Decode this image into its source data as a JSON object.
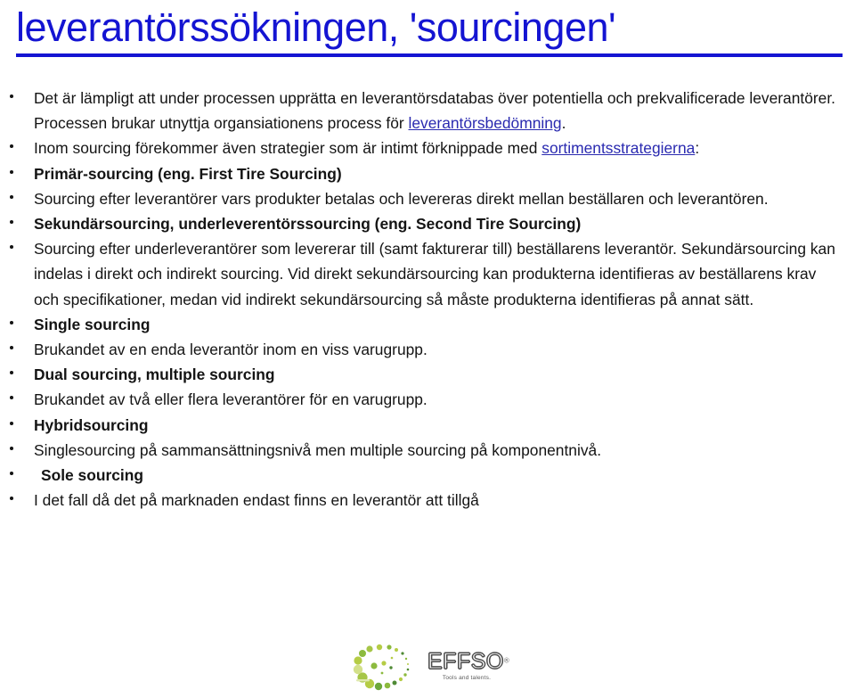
{
  "slide": {
    "title": "leverantörssökningen, 'sourcingen'",
    "title_color": "#1414d2",
    "link_color": "#2a2ab0",
    "text_color": "#141414",
    "background": "#ffffff"
  },
  "bullets": [
    {
      "id": "intro-database",
      "bold": false,
      "segments": [
        {
          "text": "Det är lämpligt att under processen upprätta en leverantörsdatabas över potentiella och prekvalificerade leverantörer. Processen brukar utnyttja organsiationens process för ",
          "link": false
        },
        {
          "text": "leverantörsbedömning",
          "link": true
        },
        {
          "text": ".",
          "link": false
        }
      ]
    },
    {
      "id": "strategies",
      "bold": false,
      "segments": [
        {
          "text": "Inom sourcing förekommer även strategier som är intimt förknippade med ",
          "link": false
        },
        {
          "text": "sortimentsstrategierna",
          "link": true
        },
        {
          "text": ":",
          "link": false
        }
      ]
    },
    {
      "id": "primar-sourcing-heading",
      "bold": true,
      "segments": [
        {
          "text": "Primär-sourcing (eng. First Tire Sourcing)",
          "link": false
        }
      ]
    },
    {
      "id": "primar-sourcing-desc",
      "bold": false,
      "segments": [
        {
          "text": "Sourcing efter leverantörer vars produkter betalas och levereras direkt mellan beställaren och leverantören.",
          "link": false
        }
      ]
    },
    {
      "id": "sekundarsourcing-heading",
      "bold": true,
      "segments": [
        {
          "text": "Sekundärsourcing, underleverentörssourcing (eng. Second Tire Sourcing)",
          "link": false
        }
      ]
    },
    {
      "id": "sekundarsourcing-desc",
      "bold": false,
      "segments": [
        {
          "text": "Sourcing efter underleverantörer som levererar till (samt fakturerar till) beställarens leverantör. Sekundärsourcing kan indelas i direkt och indirekt sourcing. Vid direkt sekundärsourcing kan produkterna identifieras av beställarens krav och specifikationer, medan vid indirekt sekundärsourcing så måste produkterna identifieras på annat sätt.",
          "link": false
        }
      ]
    },
    {
      "id": "single-sourcing-heading",
      "bold": true,
      "segments": [
        {
          "text": "Single sourcing",
          "link": false
        }
      ]
    },
    {
      "id": "single-sourcing-desc",
      "bold": false,
      "segments": [
        {
          "text": "Brukandet av en enda leverantör inom en viss varugrupp.",
          "link": false
        }
      ]
    },
    {
      "id": "dual-sourcing-heading",
      "bold": true,
      "segments": [
        {
          "text": "Dual sourcing, multiple sourcing",
          "link": false
        }
      ]
    },
    {
      "id": "dual-sourcing-desc",
      "bold": false,
      "segments": [
        {
          "text": "Brukandet av två eller flera leverantörer för en varugrupp.",
          "link": false
        }
      ]
    },
    {
      "id": "hybridsourcing-heading",
      "bold": true,
      "segments": [
        {
          "text": "Hybridsourcing",
          "link": false
        }
      ]
    },
    {
      "id": "hybridsourcing-desc",
      "bold": false,
      "segments": [
        {
          "text": "Singlesourcing på sammansättningsnivå men multiple sourcing på komponentnivå.",
          "link": false
        }
      ]
    },
    {
      "id": "sole-sourcing-heading",
      "bold": true,
      "extra_indent": true,
      "segments": [
        {
          "text": "Sole sourcing",
          "link": false
        }
      ]
    },
    {
      "id": "sole-sourcing-desc",
      "bold": false,
      "segments": [
        {
          "text": "I det fall då det på marknaden endast finns en leverantör att tillgå",
          "link": false
        }
      ]
    }
  ],
  "logo": {
    "wordmark": "EFFSO",
    "registered_mark": "®",
    "tagline": "Tools and talents.",
    "colors": {
      "light_green": "#b5cc45",
      "mid_green": "#8cba3e",
      "dark_green": "#4f8a35",
      "pale_green": "#d3e08a",
      "word_stroke": "#4a4a4a"
    }
  }
}
